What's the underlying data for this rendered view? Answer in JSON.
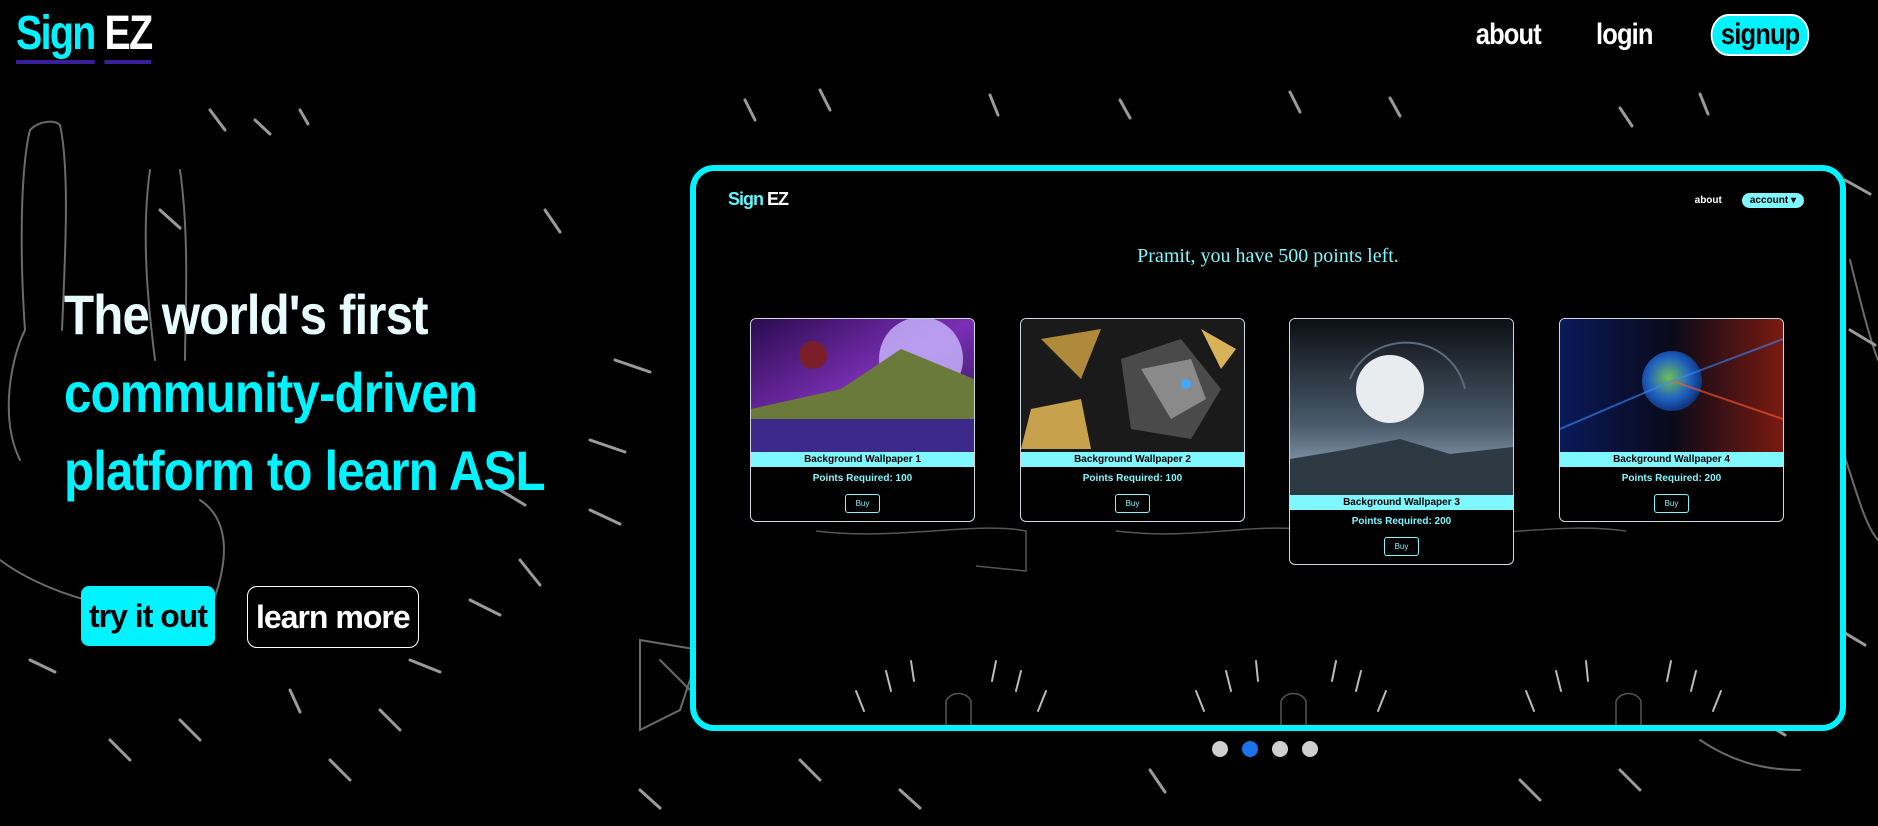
{
  "nav": {
    "logo_sign": "Sign",
    "logo_ez": "EZ",
    "about": "about",
    "login": "login",
    "signup": "signup"
  },
  "hero": {
    "line1": "The world's first",
    "line2": "community-driven",
    "line3": "platform to learn ASL",
    "try_it_out": "try it out",
    "learn_more": "learn more"
  },
  "preview": {
    "logo_sign": "Sign",
    "logo_ez": "EZ",
    "about": "about",
    "account": "account ▾",
    "points_message": "Pramit, you have 500 points left.",
    "cards": [
      {
        "title": "Background Wallpaper 1",
        "points": "Points Required: 100",
        "buy": "Buy"
      },
      {
        "title": "Background Wallpaper 2",
        "points": "Points Required: 100",
        "buy": "Buy"
      },
      {
        "title": "Background Wallpaper 3",
        "points": "Points Required: 200",
        "buy": "Buy"
      },
      {
        "title": "Background Wallpaper 4",
        "points": "Points Required: 200",
        "buy": "Buy"
      }
    ]
  },
  "carousel": {
    "slides": 4,
    "active_slide": 2
  },
  "colors": {
    "accent": "#00f3ff",
    "background": "#000000",
    "dot_active": "#1a73e8",
    "dot_inactive": "#cfcfcf"
  }
}
